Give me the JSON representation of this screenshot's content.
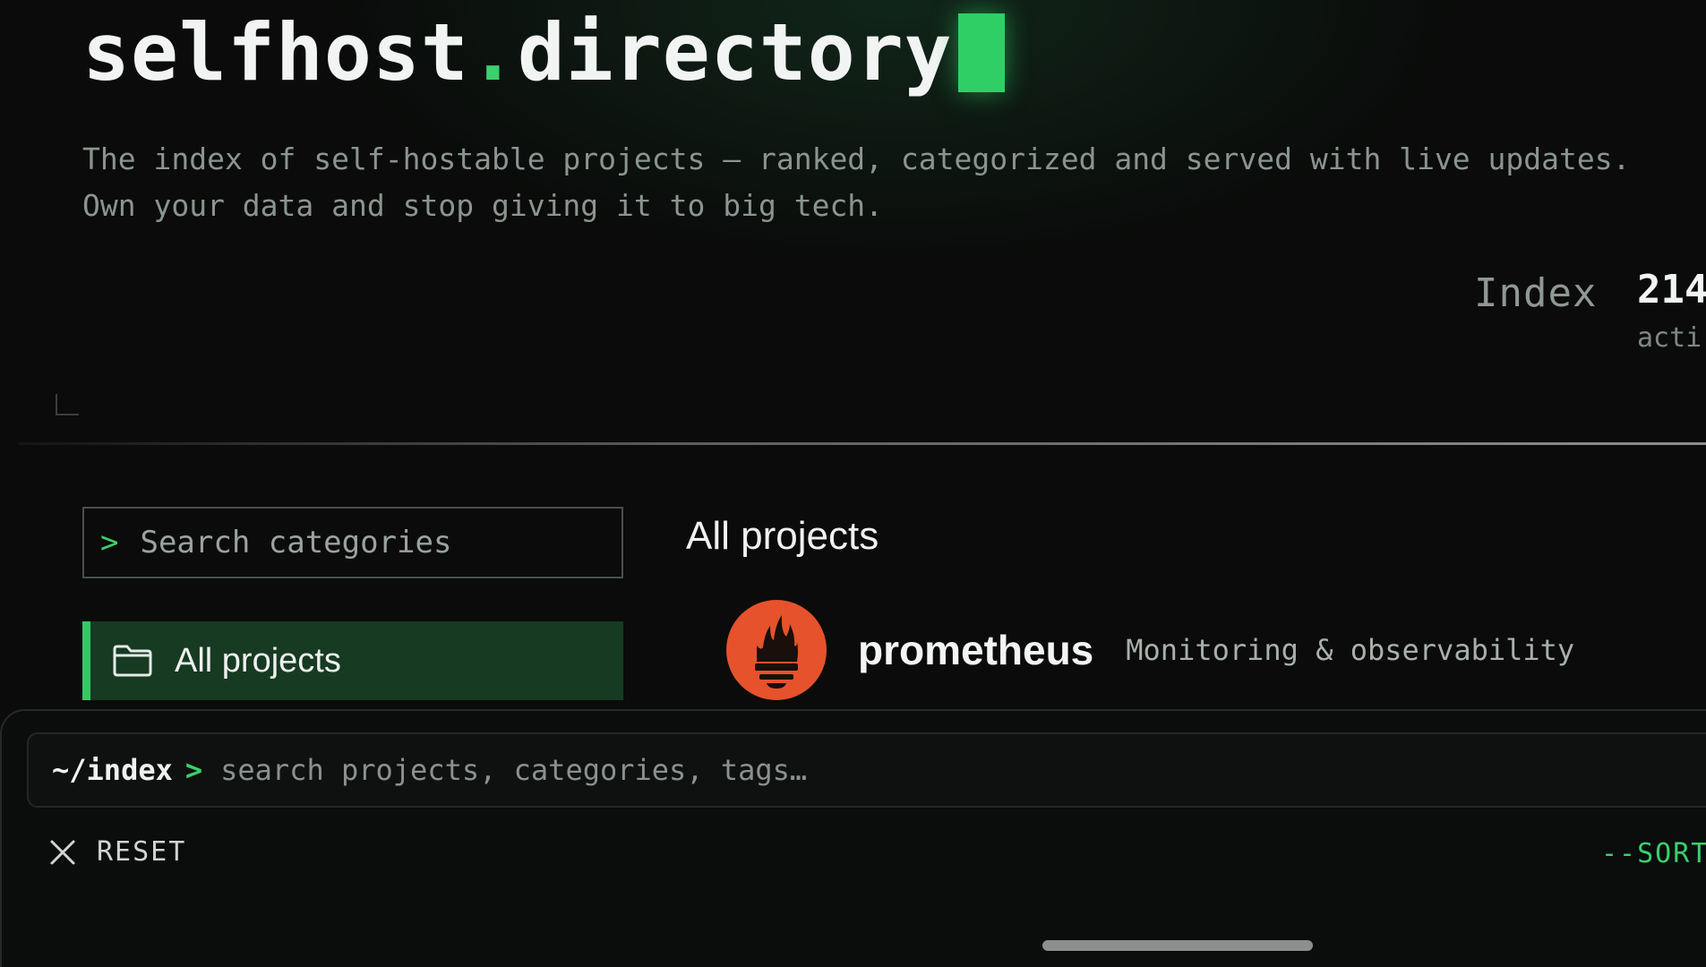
{
  "header": {
    "title_prefix": "selfhost",
    "title_dot": ".",
    "title_suffix": "directory",
    "tagline_line1": "The index of self-hostable projects — ranked, categorized and served with live updates.",
    "tagline_line2": "Own your data and stop giving it to big tech."
  },
  "stats": {
    "label": "Index",
    "value": "214",
    "sublabel": "acti"
  },
  "sidebar": {
    "search_prompt": ">",
    "search_placeholder": "Search categories",
    "active_category": "All projects"
  },
  "main": {
    "heading": "All projects",
    "projects": [
      {
        "name": "prometheus",
        "category": "Monitoring & observability",
        "logo_color": "#e6522c"
      }
    ]
  },
  "command_bar": {
    "path": "~/index",
    "caret": ">",
    "placeholder": "search projects, categories, tags…",
    "reset_label": "RESET",
    "sort_label": "--SORT"
  },
  "colors": {
    "accent": "#3ad06c",
    "active_bg": "#173a22",
    "background": "#0a0b0a"
  }
}
